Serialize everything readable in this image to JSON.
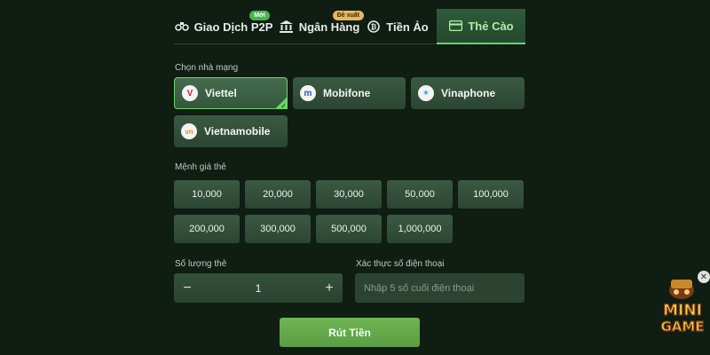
{
  "tabs": [
    {
      "label": "Giao Dịch P2P",
      "badge": "Mới",
      "icon": "handshake-icon"
    },
    {
      "label": "Ngân Hàng",
      "badge": "Đề xuất",
      "icon": "bank-icon"
    },
    {
      "label": "Tiền Ảo",
      "icon": "crypto-coin-icon"
    },
    {
      "label": "Thẻ Cào",
      "icon": "card-icon",
      "active": true
    }
  ],
  "carrier_section": {
    "label": "Chọn nhà mạng",
    "carriers": [
      {
        "name": "Viettel",
        "logo": "V",
        "logo_color": "#d8232a",
        "selected": true
      },
      {
        "name": "Mobifone",
        "logo": "m",
        "logo_color": "#1b5fb4"
      },
      {
        "name": "Vinaphone",
        "logo": "✶",
        "logo_color": "#2aa0dd"
      },
      {
        "name": "Vietnamobile",
        "logo": "vn",
        "logo_color": "#f08a1c"
      }
    ]
  },
  "denomination_section": {
    "label": "Mệnh giá thẻ",
    "values": [
      "10,000",
      "20,000",
      "30,000",
      "50,000",
      "100,000",
      "200,000",
      "300,000",
      "500,000",
      "1,000,000"
    ]
  },
  "quantity": {
    "label": "Số lượng thẻ",
    "minus": "−",
    "value": "1",
    "plus": "+"
  },
  "phone_verify": {
    "label": "Xác thực số điện thoại",
    "placeholder": "Nhập 5 số cuối điện thoại"
  },
  "submit_label": "Rút Tiền",
  "mini_game": {
    "text_top": "MINI",
    "text_bottom": "GAME",
    "close": "✕"
  },
  "colors": {
    "background": "#0f1d13",
    "accent": "#6bd46a",
    "submit": "#66ad4e"
  }
}
